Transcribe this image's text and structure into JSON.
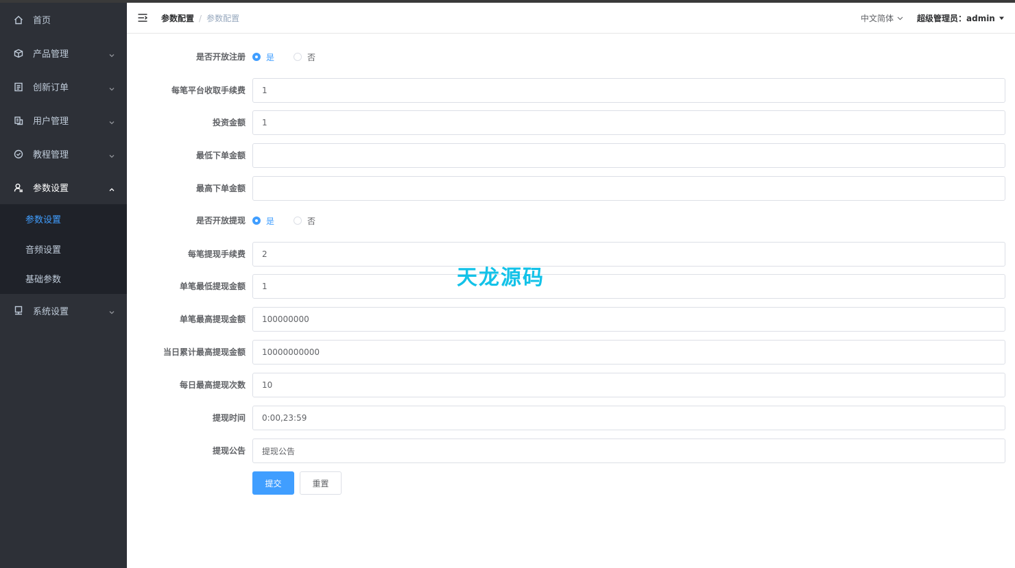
{
  "sidebar": {
    "items": [
      {
        "label": "首页",
        "icon": "home-icon"
      },
      {
        "label": "产品管理",
        "icon": "box-icon"
      },
      {
        "label": "创新订单",
        "icon": "order-icon"
      },
      {
        "label": "用户管理",
        "icon": "users-icon"
      },
      {
        "label": "教程管理",
        "icon": "check-circle-icon"
      },
      {
        "label": "参数设置",
        "icon": "user-setting-icon"
      },
      {
        "label": "系统设置",
        "icon": "monitor-icon"
      }
    ],
    "submenu": [
      "参数设置",
      "音频设置",
      "基础参数"
    ]
  },
  "navbar": {
    "breadcrumb_first": "参数配置",
    "breadcrumb_sep": "/",
    "breadcrumb_second": "参数配置",
    "language": "中文简体",
    "user": "超级管理员：admin"
  },
  "form": {
    "open_register_label": "是否开放注册",
    "radio_yes": "是",
    "radio_no": "否",
    "platform_fee_label": "每笔平台收取手续费",
    "platform_fee_value": "1",
    "invest_amount_label": "投资金额",
    "invest_amount_value": "1",
    "min_order_label": "最低下单金额",
    "min_order_value": "",
    "max_order_label": "最高下单金额",
    "max_order_value": "",
    "open_withdraw_label": "是否开放提现",
    "withdraw_fee_label": "每笔提现手续费",
    "withdraw_fee_value": "2",
    "single_min_withdraw_label": "单笔最低提现金额",
    "single_min_withdraw_value": "1",
    "single_max_withdraw_label": "单笔最高提现金额",
    "single_max_withdraw_value": "100000000",
    "daily_total_max_label": "当日累计最高提现金额",
    "daily_total_max_value": "10000000000",
    "daily_max_count_label": "每日最高提现次数",
    "daily_max_count_value": "10",
    "withdraw_time_label": "提现时间",
    "withdraw_time_value": "0:00,23:59",
    "withdraw_notice_label": "提现公告",
    "withdraw_notice_value": "提现公告",
    "submit_label": "提交",
    "reset_label": "重置"
  },
  "watermark": "天龙源码",
  "colors": {
    "accent": "#409eff",
    "sidebar_bg": "#2d3037",
    "submenu_bg": "#1f2229",
    "watermark": "#13c2e8"
  }
}
